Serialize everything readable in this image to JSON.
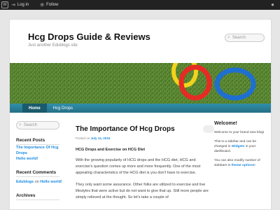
{
  "adminbar": {
    "wp_glyph": "W",
    "login_icon": "login-icon",
    "login": "Log in",
    "follow_icon": "plus-icon",
    "follow": "Follow",
    "right_icon": "circle-icon"
  },
  "site": {
    "title": "Hcg Drops Guide & Reviews",
    "description": "Just another Edublogs site"
  },
  "search": {
    "placeholder": "Search"
  },
  "nav": {
    "items": [
      "Home",
      "Hcg Drops"
    ]
  },
  "sidebar_left": {
    "search_placeholder": "Search",
    "recent_posts_title": "Recent Posts",
    "recent_posts": [
      "The Importance Of Hcg Drops",
      "Hello world!"
    ],
    "recent_comments_title": "Recent Comments",
    "comment_author": "Edublogs",
    "comment_on": " on ",
    "comment_post": "Hello world!",
    "archives_title": "Archives"
  },
  "post": {
    "title": "The Importance Of Hcg Drops",
    "posted_on": "Posted on ",
    "date": "July 14, 2016",
    "subtitle": "HCG Drops and Exercise on HCG Diet",
    "paragraph1": "With the growing popularity of HCG drops and the HCG diet, HCG and exercise's question comes up more and more frequently. One of the most appealing characteristics of the HCG diet is you don't have to exercise.",
    "paragraph2": "They only want some assurance. Other folks are utilized to exercise and live lifestyles that were active but do not want to give that up. Still more people are simply relieved at the thought. So let's take a couple of"
  },
  "sidebar_right": {
    "title": "Welcome!",
    "p1": "Welcome to your brand new blog!",
    "p2_a": "This is a sidebar and can be changed in ",
    "p2_link": "Widgets",
    "p2_b": " in your dashboard.",
    "p3_a": "You can also modify number of sidebars in ",
    "p3_link": "theme options",
    "p3_b": "!"
  },
  "colors": {
    "nav": "#2a7f97",
    "link": "#1b8be0",
    "adminbar": "#222222"
  }
}
